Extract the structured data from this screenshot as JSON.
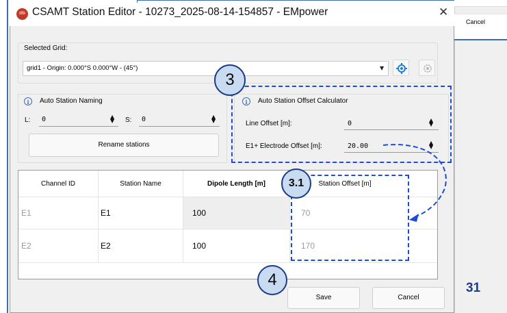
{
  "dialog": {
    "title": "CSAMT Station Editor - 10273_2025-08-14-154857 - EMpower",
    "close_glyph": "✕"
  },
  "background": {
    "cancel_label": "Cancel",
    "page_number": "31"
  },
  "selected_grid": {
    "group_label": "Selected Grid:",
    "combo_value": "grid1 - Origin: 0.000°S 0.000°W - (45°)",
    "icons": [
      "grid-settings-icon",
      "grid-options-icon"
    ]
  },
  "auto_naming": {
    "group_label": "Auto Station Naming",
    "line_label": "L:",
    "line_value": "0",
    "station_label": "S:",
    "station_value": "0",
    "rename_button": "Rename stations"
  },
  "offset_calc": {
    "group_label": "Auto Station Offset Calculator",
    "line_offset_label": "Line Offset [m]:",
    "line_offset_value": "0",
    "electrode_offset_label": "E1+ Electrode Offset [m]:",
    "electrode_offset_value": "20.00"
  },
  "table": {
    "headers": [
      "Channel ID",
      "Station Name",
      "Dipole Length [m]",
      "Station Offset [m]"
    ],
    "rows": [
      {
        "channel_id": "E1",
        "station_name": "E1",
        "dipole_length": "100",
        "station_offset": "70"
      },
      {
        "channel_id": "E2",
        "station_name": "E2",
        "dipole_length": "100",
        "station_offset": "170"
      }
    ]
  },
  "footer": {
    "save_label": "Save",
    "cancel_label": "Cancel"
  },
  "annotations": {
    "callout_3": "3",
    "callout_3_1": "3.1",
    "callout_4": "4",
    "accent_color": "#1b4bd9"
  }
}
